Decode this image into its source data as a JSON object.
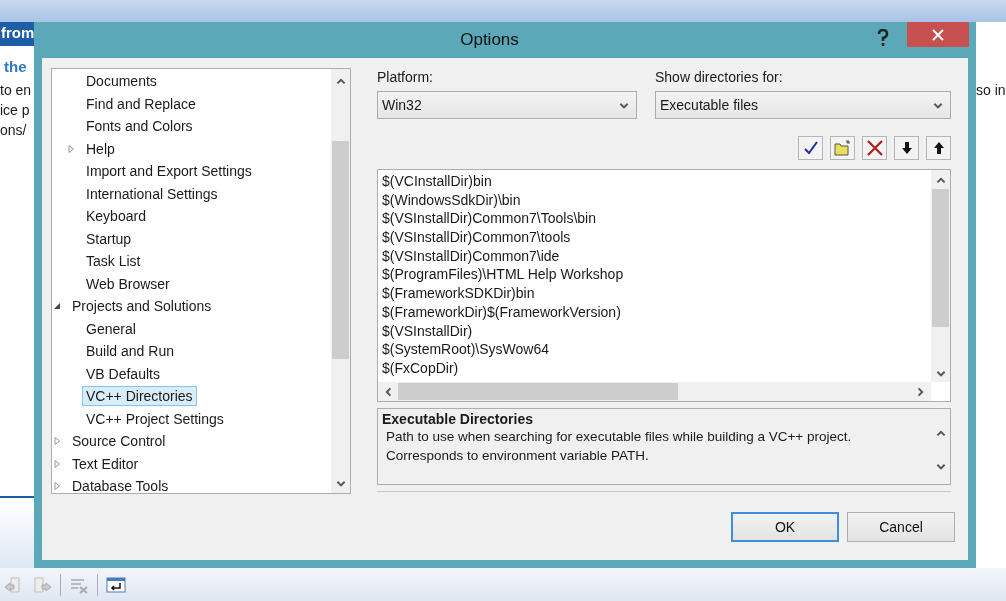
{
  "background": {
    "left_title": "from",
    "left_heading": "the",
    "left_lines": [
      "to en",
      "ice p",
      "ons/"
    ],
    "right_line": "so in"
  },
  "window": {
    "title": "Options"
  },
  "tree": {
    "items": [
      {
        "children": [
          {
            "label": "Documents",
            "selected": false
          },
          {
            "label": "Find and Replace",
            "selected": false
          },
          {
            "label": "Fonts and Colors",
            "selected": false
          },
          {
            "label": "Help",
            "expanded": false,
            "selected": false
          },
          {
            "label": "Import and Export Settings",
            "selected": false
          },
          {
            "label": "International Settings",
            "selected": false
          },
          {
            "label": "Keyboard",
            "selected": false
          },
          {
            "label": "Startup",
            "selected": false
          },
          {
            "label": "Task List",
            "selected": false
          },
          {
            "label": "Web Browser",
            "selected": false
          }
        ]
      },
      {
        "label": "Projects and Solutions",
        "expanded": true,
        "selected": false,
        "children": [
          {
            "label": "General",
            "selected": false
          },
          {
            "label": "Build and Run",
            "selected": false
          },
          {
            "label": "VB Defaults",
            "selected": false
          },
          {
            "label": "VC++ Directories",
            "selected": true
          },
          {
            "label": "VC++ Project Settings",
            "selected": false
          }
        ]
      },
      {
        "label": "Source Control",
        "expanded": false,
        "selected": false
      },
      {
        "label": "Text Editor",
        "expanded": false,
        "selected": false
      },
      {
        "label": "Database Tools",
        "expanded": false,
        "selected": false
      }
    ]
  },
  "platform": {
    "label": "Platform:",
    "value": "Win32"
  },
  "show_for": {
    "label": "Show directories for:",
    "value": "Executable files"
  },
  "toolbar": [
    {
      "kind": "check"
    },
    {
      "kind": "new-folder"
    },
    {
      "kind": "delete"
    },
    {
      "kind": "down"
    },
    {
      "kind": "up"
    }
  ],
  "paths": [
    "$(VCInstallDir)bin",
    "$(WindowsSdkDir)\\bin",
    "$(VSInstallDir)Common7\\Tools\\bin",
    "$(VSInstallDir)Common7\\tools",
    "$(VSInstallDir)Common7\\ide",
    "$(ProgramFiles)\\HTML Help Workshop",
    "$(FrameworkSDKDir)bin",
    "$(FrameworkDir)$(FrameworkVersion)",
    "$(VSInstallDir)",
    "$(SystemRoot)\\SysWow64",
    "$(FxCopDir)"
  ],
  "description": {
    "title": "Executable Directories",
    "text": "Path to use when searching for executable files while building a VC++ project. Corresponds to environment variable PATH."
  },
  "buttons": [
    {
      "label": "OK",
      "default": true
    },
    {
      "label": "Cancel",
      "default": false
    }
  ]
}
